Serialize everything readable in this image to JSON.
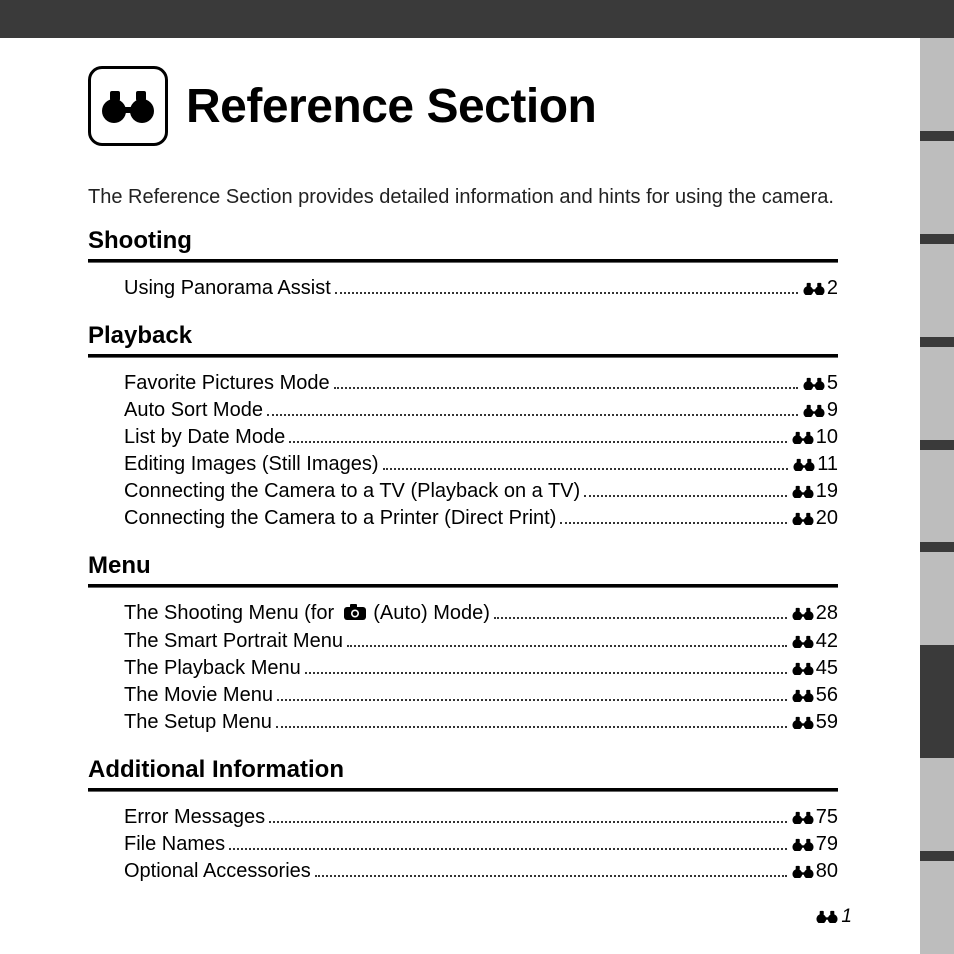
{
  "title": "Reference Section",
  "intro": "The Reference Section provides detailed information and hints for using the camera.",
  "page_number": "1",
  "sections": [
    {
      "heading": "Shooting",
      "items": [
        {
          "label": "Using Panorama Assist",
          "page": "2"
        }
      ]
    },
    {
      "heading": "Playback",
      "items": [
        {
          "label": "Favorite Pictures Mode",
          "page": "5"
        },
        {
          "label": "Auto Sort Mode",
          "page": "9"
        },
        {
          "label": "List by Date Mode",
          "page": "10"
        },
        {
          "label": "Editing Images (Still Images)",
          "page": "11"
        },
        {
          "label": "Connecting the Camera to a TV (Playback on a TV)",
          "page": "19"
        },
        {
          "label": "Connecting the Camera to a Printer (Direct Print)",
          "page": "20"
        }
      ]
    },
    {
      "heading": "Menu",
      "items": [
        {
          "label_prefix": "The Shooting Menu (for ",
          "has_camera_icon": true,
          "label_suffix": " (Auto) Mode)",
          "page": "28"
        },
        {
          "label": "The Smart Portrait Menu",
          "page": "42"
        },
        {
          "label": "The Playback Menu",
          "page": "45"
        },
        {
          "label": "The Movie Menu",
          "page": "56"
        },
        {
          "label": "The Setup Menu",
          "page": "59"
        }
      ]
    },
    {
      "heading": "Additional Information",
      "items": [
        {
          "label": "Error Messages",
          "page": "75"
        },
        {
          "label": "File Names",
          "page": "79"
        },
        {
          "label": "Optional Accessories",
          "page": "80"
        }
      ]
    }
  ],
  "side_tabs": [
    {
      "active": false
    },
    {
      "active": false
    },
    {
      "active": false
    },
    {
      "active": false
    },
    {
      "active": false
    },
    {
      "active": false
    },
    {
      "active": true
    },
    {
      "active": false
    },
    {
      "active": false
    }
  ]
}
